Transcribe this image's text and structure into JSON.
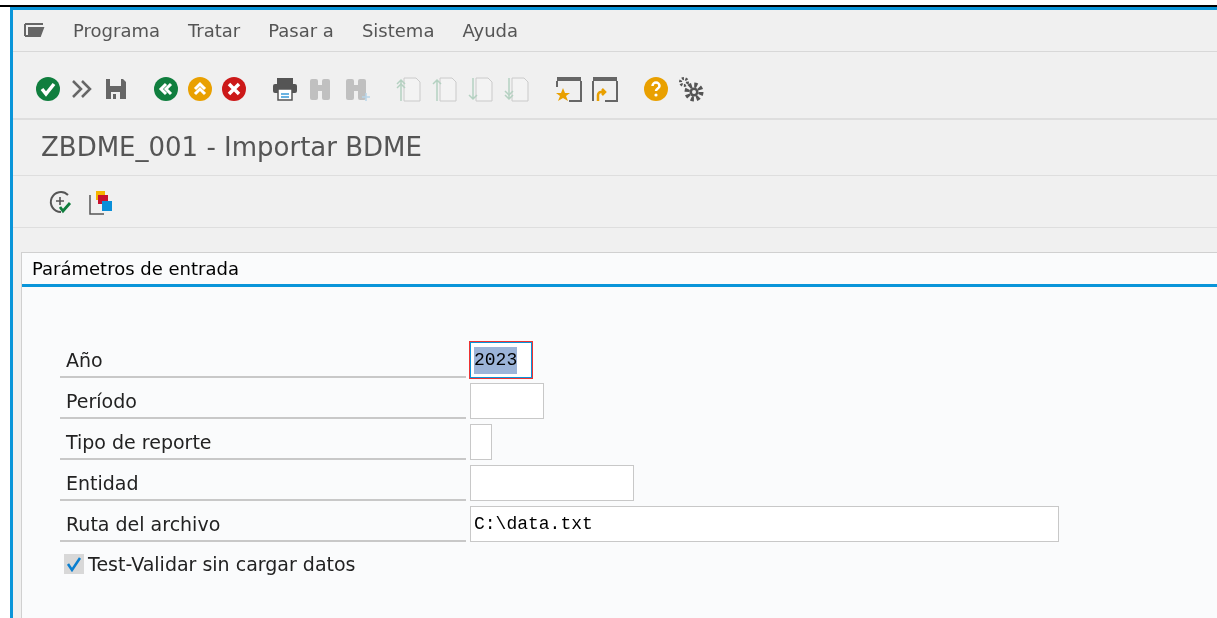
{
  "menu_bar": {
    "items": [
      {
        "label": "Programa"
      },
      {
        "label": "Tratar"
      },
      {
        "label": "Pasar a"
      },
      {
        "label": "Sistema"
      },
      {
        "label": "Ayuda"
      }
    ]
  },
  "toolbar": {
    "buttons": [
      {
        "kind": "enter",
        "disabled": false
      },
      {
        "kind": "command",
        "disabled": false
      },
      {
        "kind": "save",
        "disabled": false
      },
      {
        "kind": "back",
        "disabled": false
      },
      {
        "kind": "exit",
        "disabled": false
      },
      {
        "kind": "cancel",
        "disabled": false
      },
      {
        "kind": "print",
        "disabled": false
      },
      {
        "kind": "find",
        "disabled": true
      },
      {
        "kind": "find-next",
        "disabled": true
      },
      {
        "kind": "first-page",
        "disabled": true
      },
      {
        "kind": "prev-page",
        "disabled": true
      },
      {
        "kind": "next-page",
        "disabled": true
      },
      {
        "kind": "last-page",
        "disabled": true
      },
      {
        "kind": "new-window",
        "disabled": false
      },
      {
        "kind": "shortcut",
        "disabled": false
      },
      {
        "kind": "help",
        "disabled": false
      },
      {
        "kind": "settings",
        "disabled": false
      }
    ]
  },
  "title": "ZBDME_001 - Importar BDME",
  "app_toolbar": {
    "buttons": [
      {
        "kind": "execute"
      },
      {
        "kind": "variants"
      }
    ]
  },
  "group": {
    "title": "Parámetros de entrada",
    "fields": [
      {
        "label": "Año",
        "value": "2023",
        "focused": true
      },
      {
        "label": "Período",
        "focused": false
      },
      {
        "label": "Tipo de reporte",
        "focused": false
      },
      {
        "label": "Entidad",
        "focused": false
      },
      {
        "label": "Ruta del archivo",
        "value": "C:\\data.txt",
        "focused": false
      }
    ],
    "checkbox": {
      "label": "Test-Validar sin cargar datos",
      "checked": true
    }
  }
}
